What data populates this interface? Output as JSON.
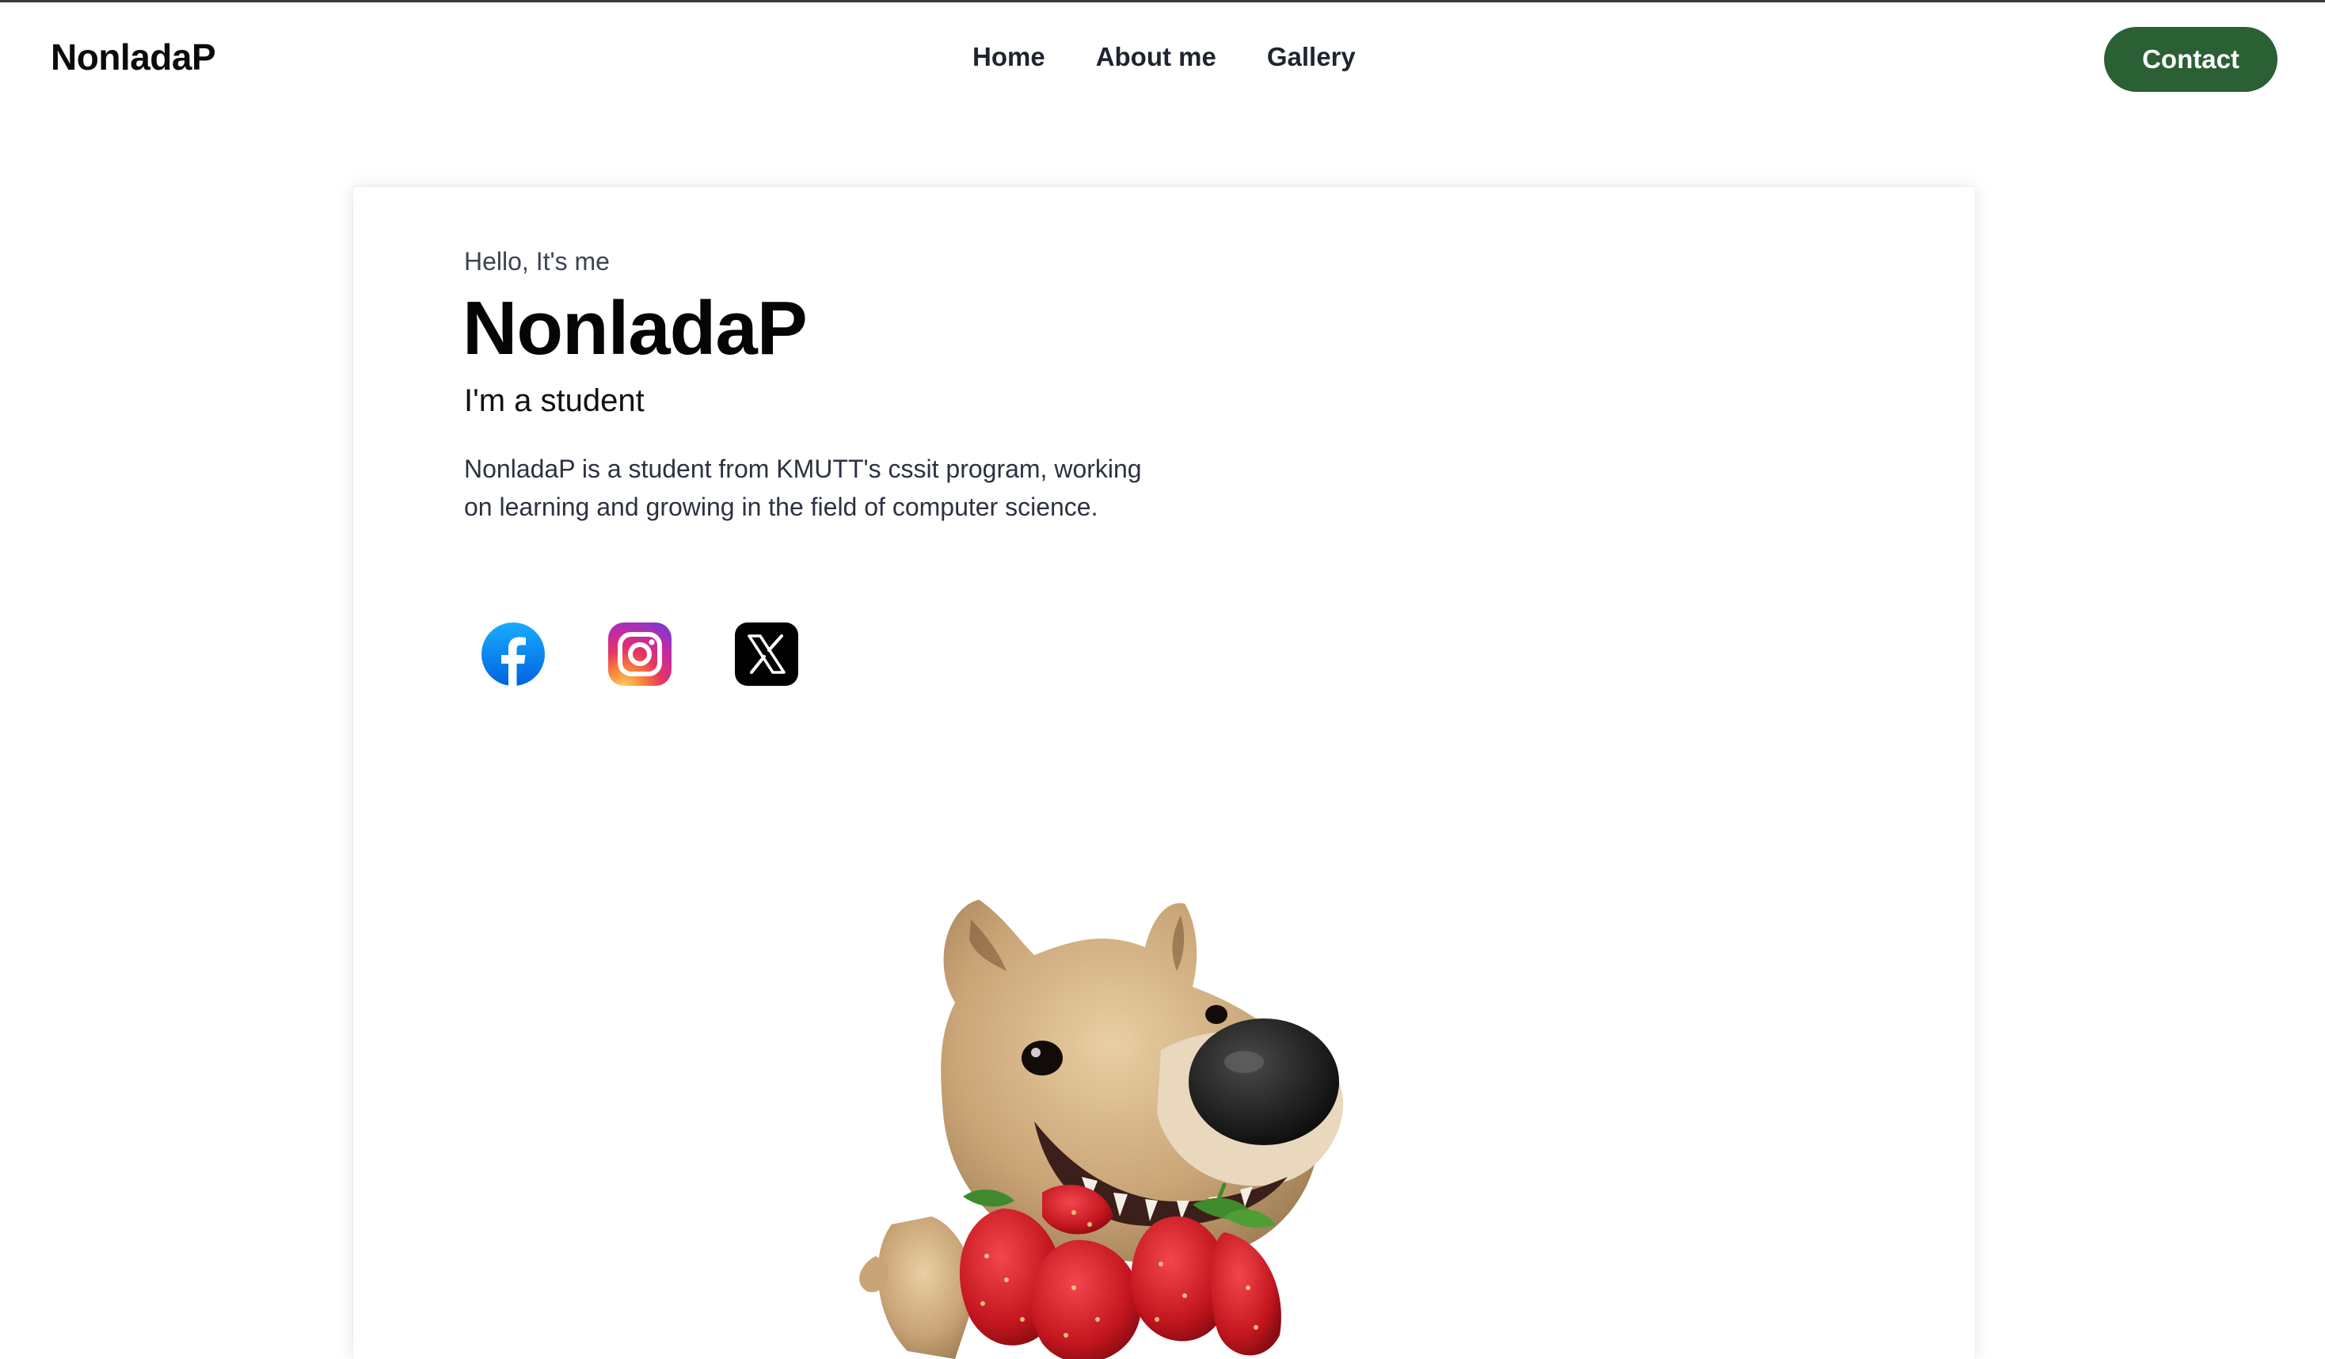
{
  "header": {
    "brand": "NonladaP",
    "nav": [
      {
        "label": "Home"
      },
      {
        "label": "About me"
      },
      {
        "label": "Gallery"
      }
    ],
    "contact_label": "Contact"
  },
  "hero": {
    "greeting": "Hello, It's me",
    "name": "NonladaP",
    "role": "I'm a student",
    "bio": "NonladaP is a student from KMUTT's cssit program, working on learning and growing in the field of computer science.",
    "socials": [
      {
        "icon": "facebook-icon"
      },
      {
        "icon": "instagram-icon"
      },
      {
        "icon": "x-icon"
      }
    ]
  },
  "colors": {
    "accent": "#2b5f34",
    "facebook": "#1877f2",
    "x": "#000000"
  }
}
